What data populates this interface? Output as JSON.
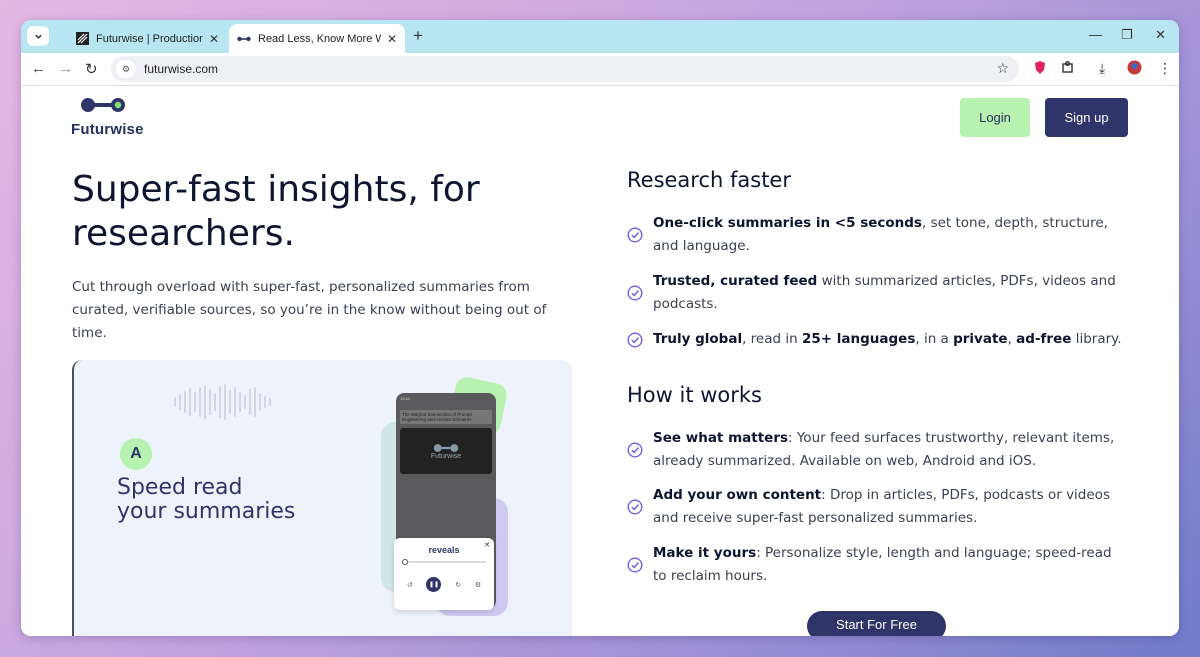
{
  "browser": {
    "tabs": [
      {
        "title": "Futurwise | Production | Sanity",
        "active": false,
        "icon": "sanity-favicon"
      },
      {
        "title": "Read Less, Know More With Fut",
        "active": true,
        "icon": "futurwise-favicon"
      }
    ],
    "new_tab": "+",
    "url": "futurwise.com"
  },
  "site": {
    "logo_text": "Futurwise",
    "login_label": "Login",
    "signup_label": "Sign up"
  },
  "hero": {
    "title": "Super-fast insights, for researchers.",
    "subtitle": "Cut through overload with super-fast, personalized summaries from curated, verifiable sources, so you’re in the know without being out of time."
  },
  "promo": {
    "badge": "A",
    "line1": "Speed read",
    "line2": "your summaries",
    "phone_status": "13:44",
    "phone_article": "The Magical Intersection of Prompt Engineering and Ancient Grimoires",
    "phone_card_logo": "Futurwise",
    "player_title": "reveals"
  },
  "research": {
    "title": "Research faster",
    "items": [
      {
        "bold": "One-click summaries in <5 seconds",
        "rest": ", set tone, depth, structure, and language."
      },
      {
        "bold": "Trusted, curated feed",
        "rest": " with summarized articles, PDFs, videos and podcasts."
      },
      {
        "bold": "Truly global",
        "rest": ", read in ",
        "bold2": "25+ languages",
        "rest2": ", in a ",
        "bold3": "private",
        "rest3": ", ",
        "bold4": "ad-free",
        "rest4": " library."
      }
    ]
  },
  "how": {
    "title": "How it works",
    "items": [
      {
        "bold": "See what matters",
        "rest": ": Your feed surfaces trustworthy, relevant items, already summarized. Available on web, Android and iOS."
      },
      {
        "bold": "Add your own content",
        "rest": ": Drop in articles, PDFs, podcasts or videos and receive super-fast personalized summaries."
      },
      {
        "bold": "Make it yours",
        "rest": ": Personalize style, length and language; speed-read to reclaim hours."
      }
    ]
  },
  "cta": {
    "start_label": "Start For Free"
  },
  "colors": {
    "navy": "#2f3568",
    "mint": "#b8f2b0",
    "check": "#6c63e8"
  }
}
